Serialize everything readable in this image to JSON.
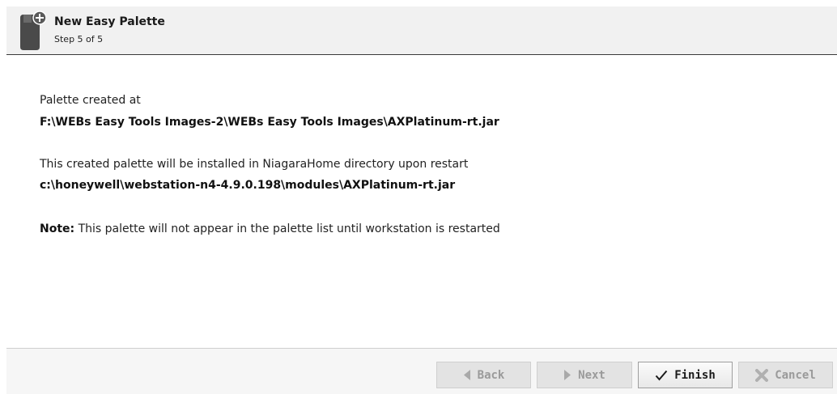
{
  "header": {
    "title": "New Easy Palette",
    "step": "Step 5 of 5"
  },
  "content": {
    "created_label": "Palette created at",
    "created_path": "F:\\WEBs Easy Tools Images-2\\WEBs Easy Tools Images\\AXPlatinum-rt.jar",
    "install_label": "This created palette will be installed in NiagaraHome directory upon restart",
    "install_path": "c:\\honeywell\\webstation-n4-4.9.0.198\\modules\\AXPlatinum-rt.jar",
    "note_label": "Note:",
    "note_text": " This palette will not appear in the palette list until workstation is restarted"
  },
  "buttons": {
    "back": "Back",
    "next": "Next",
    "finish": "Finish",
    "cancel": "Cancel"
  },
  "icons": {
    "wizard": "palette-add-icon",
    "back": "arrow-left-icon",
    "next": "arrow-right-icon",
    "finish": "checkmark-icon",
    "cancel": "cross-icon"
  },
  "colors": {
    "header_bg": "#f1f1f1",
    "disabled_text": "#9a9a9a"
  }
}
